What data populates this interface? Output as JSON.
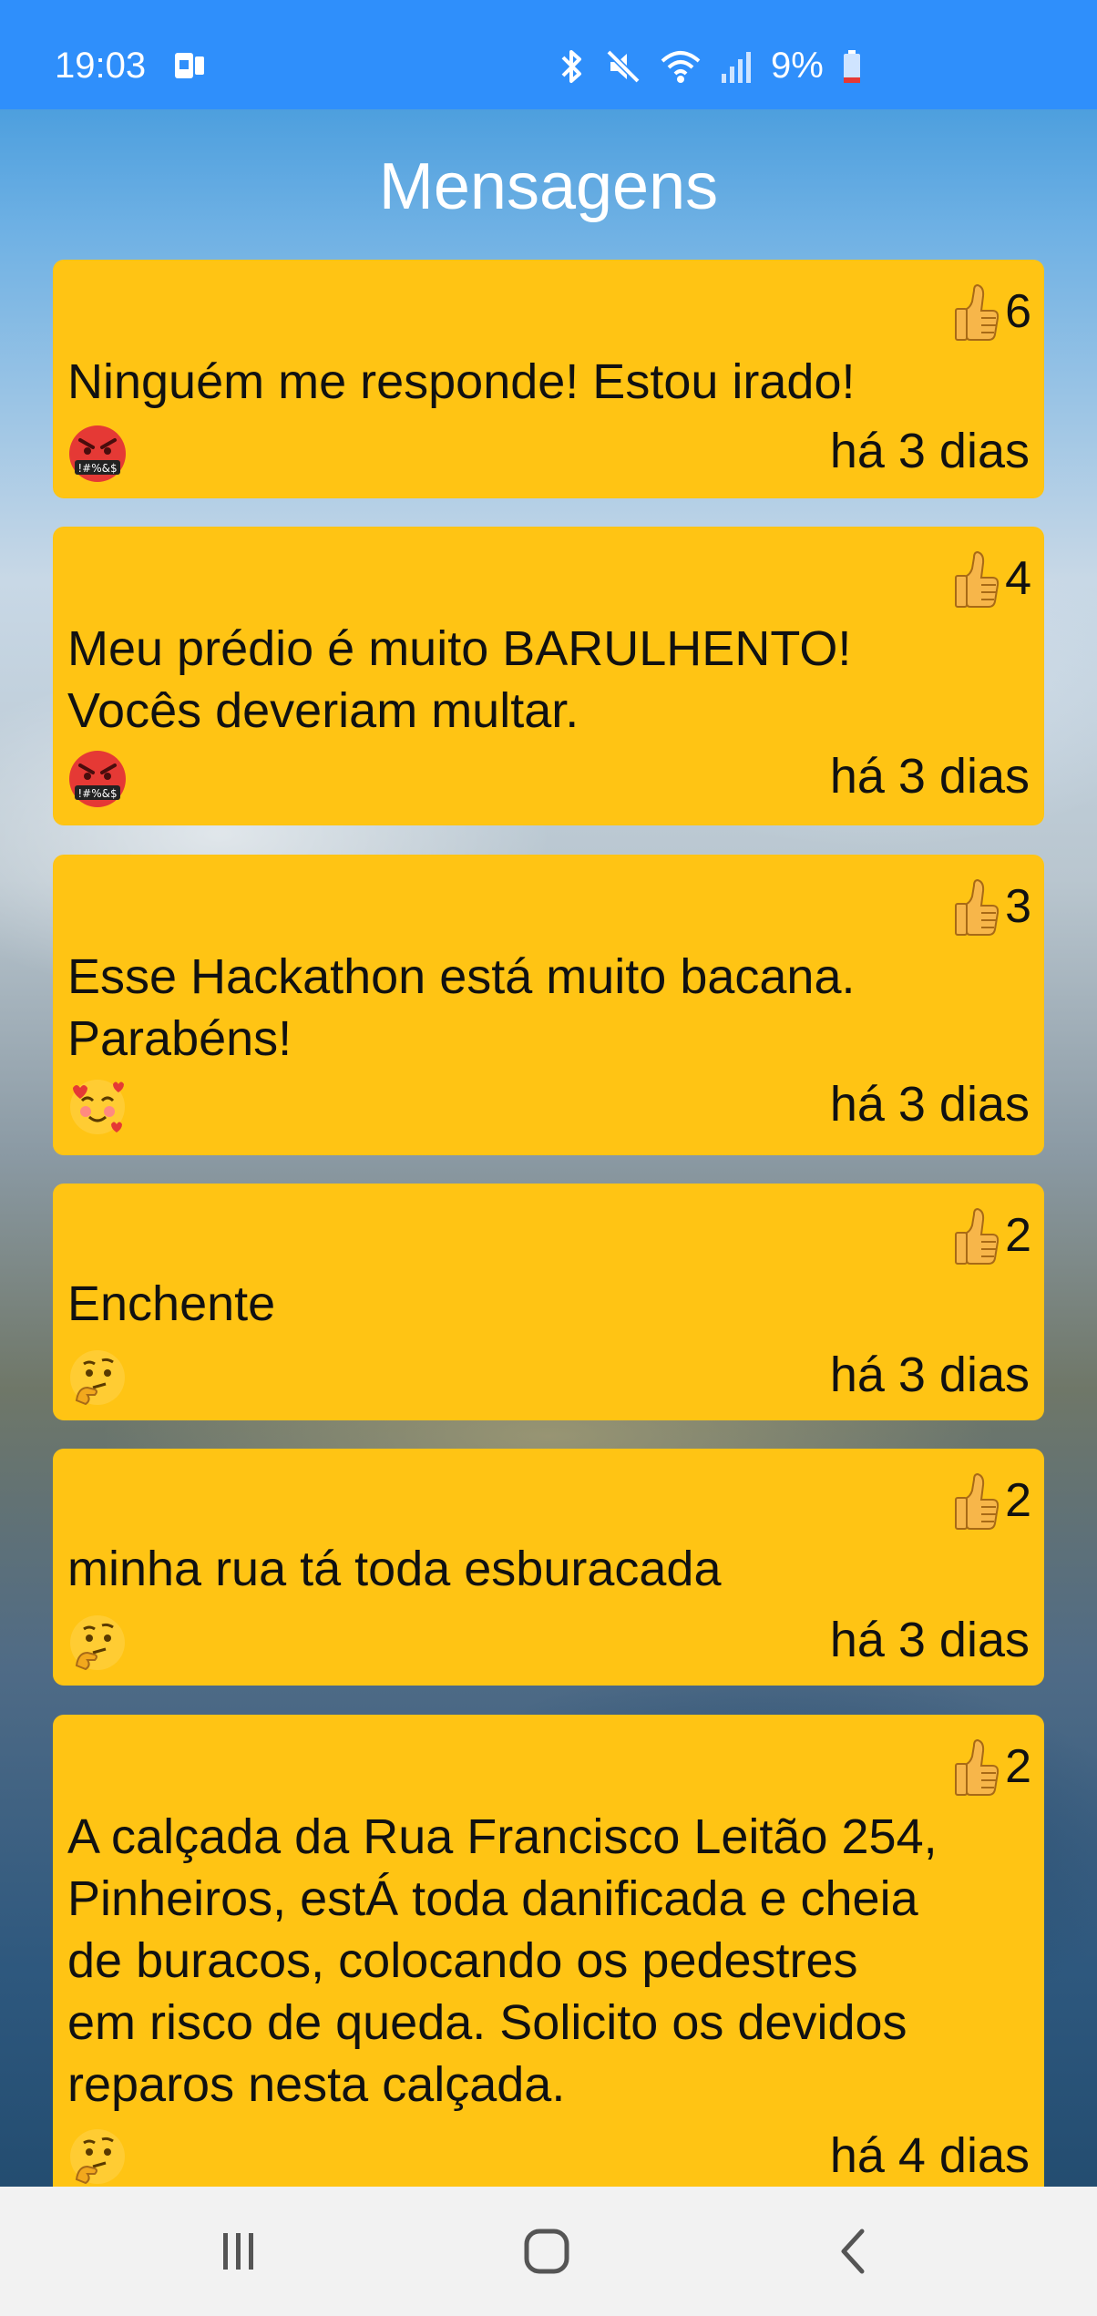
{
  "status_bar": {
    "time": "19:03",
    "battery_percent": "9%",
    "icons": [
      "sim-card-icon",
      "bluetooth-icon",
      "mute-icon",
      "wifi-icon",
      "signal-icon",
      "battery-low-icon"
    ]
  },
  "header": {
    "title": "Mensagens"
  },
  "colors": {
    "status_bar": "#2f8ffb",
    "card": "#ffc414",
    "text": "#111111",
    "nav_bar": "#f2f2f2"
  },
  "messages": [
    {
      "likes": "6",
      "text": "Ninguém me responde! Estou irado!",
      "emoji": "angry-cursing-emoji",
      "time": "há 3 dias"
    },
    {
      "likes": "4",
      "text": "Meu prédio é muito BARULHENTO!\nVocês deveriam multar.",
      "emoji": "angry-cursing-emoji",
      "time": "há 3 dias"
    },
    {
      "likes": "3",
      "text": "Esse Hackathon está muito bacana.\nParabéns!",
      "emoji": "smiling-hearts-emoji",
      "time": "há 3 dias"
    },
    {
      "likes": "2",
      "text": "Enchente",
      "emoji": "thinking-face-emoji",
      "time": "há 3 dias"
    },
    {
      "likes": "2",
      "text": "minha rua tá toda esburacada",
      "emoji": "thinking-face-emoji",
      "time": "há 3 dias"
    },
    {
      "likes": "2",
      "text": "A calçada da Rua Francisco Leitão 254,\nPinheiros, estÁ toda danificada e cheia\nde buracos, colocando os pedestres\nem risco de queda. Solicito os devidos\nreparos nesta calçada.",
      "emoji": "thinking-face-emoji",
      "time": "há 4 dias"
    }
  ],
  "nav": {
    "icons": [
      "recent-apps-icon",
      "home-icon",
      "back-icon"
    ]
  }
}
